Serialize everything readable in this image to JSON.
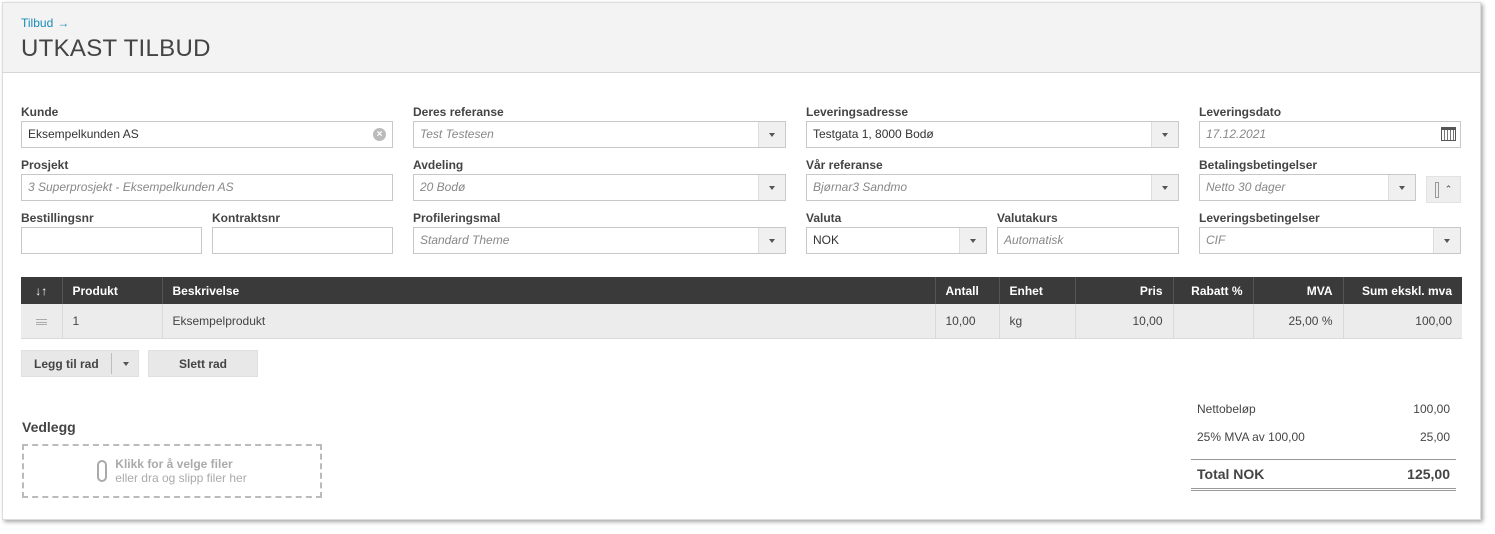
{
  "header": {
    "breadcrumb": "Tilbud",
    "breadcrumb_arrow": "→",
    "title": "UTKAST TILBUD"
  },
  "form": {
    "kunde": {
      "label": "Kunde",
      "value": "Eksempelkunden AS"
    },
    "deres_referanse": {
      "label": "Deres referanse",
      "value": "Test Testesen"
    },
    "leveringsadresse": {
      "label": "Leveringsadresse",
      "value": "Testgata 1, 8000 Bodø"
    },
    "leveringsdato": {
      "label": "Leveringsdato",
      "value": "17.12.2021"
    },
    "prosjekt": {
      "label": "Prosjekt",
      "value": "3 Superprosjekt - Eksempelkunden AS"
    },
    "avdeling": {
      "label": "Avdeling",
      "value": "20 Bodø"
    },
    "var_referanse": {
      "label": "Vår referanse",
      "value": "Bjørnar3 Sandmo"
    },
    "betalingsbetingelser": {
      "label": "Betalingsbetingelser",
      "value": "Netto 30 dager"
    },
    "bestillingsnr": {
      "label": "Bestillingsnr",
      "value": ""
    },
    "kontraktsnr": {
      "label": "Kontraktsnr",
      "value": ""
    },
    "profileringsmal": {
      "label": "Profileringsmal",
      "value": "Standard Theme"
    },
    "valuta": {
      "label": "Valuta",
      "value": "NOK"
    },
    "valutakurs": {
      "label": "Valutakurs",
      "placeholder": "Automatisk"
    },
    "leveringsbetingelser": {
      "label": "Leveringsbetingelser",
      "value": "CIF"
    }
  },
  "table": {
    "columns": {
      "sort": "↓↑",
      "produkt": "Produkt",
      "beskrivelse": "Beskrivelse",
      "antall": "Antall",
      "enhet": "Enhet",
      "pris": "Pris",
      "rabatt": "Rabatt %",
      "mva": "MVA",
      "sum": "Sum ekskl. mva"
    },
    "rows": [
      {
        "produkt": "1",
        "beskrivelse": "Eksempelprodukt",
        "antall": "10,00",
        "enhet": "kg",
        "pris": "10,00",
        "rabatt": "",
        "mva": "25,00 %",
        "sum": "100,00"
      }
    ]
  },
  "actions": {
    "add_row": "Legg til rad",
    "delete_row": "Slett rad"
  },
  "attachments": {
    "title": "Vedlegg",
    "line1": "Klikk for å velge filer",
    "line2": "eller dra og slipp filer her"
  },
  "totals": {
    "netto_label": "Nettobeløp",
    "netto_value": "100,00",
    "mva_label": "25% MVA av 100,00",
    "mva_value": "25,00",
    "total_label": "Total NOK",
    "total_value": "125,00"
  },
  "icons": {
    "clear": "clear-icon",
    "calendar": "calendar-icon",
    "dropdown": "chevron-down-icon",
    "collapse": "chevron-up-icon",
    "attachment": "paperclip-icon",
    "drag": "drag-handle-icon"
  },
  "colors": {
    "accent": "#1a8cb8",
    "table_header": "#3a3a3a"
  }
}
